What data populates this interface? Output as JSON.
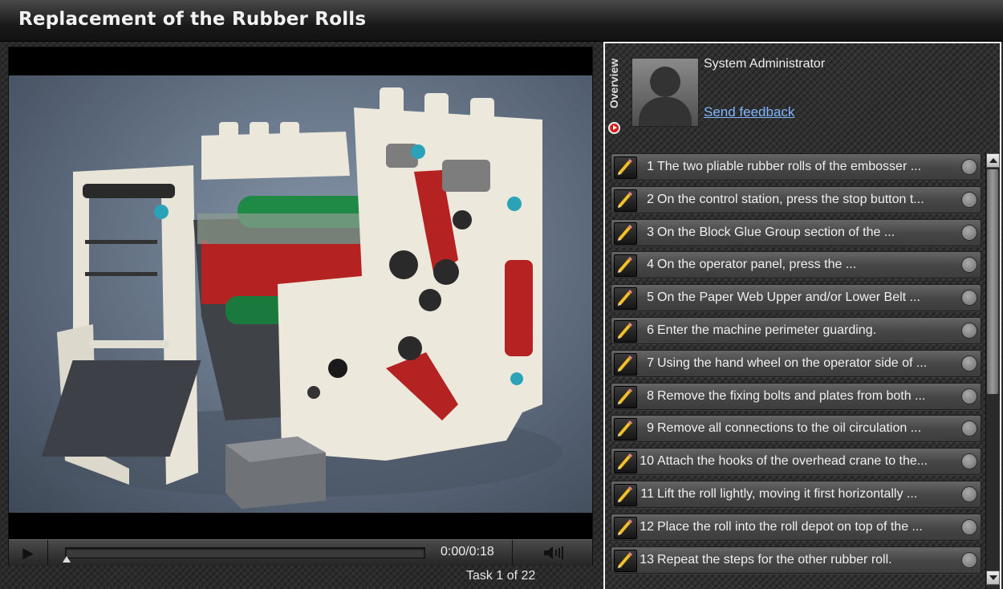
{
  "header": {
    "title": "Replacement of the Rubber Rolls"
  },
  "player": {
    "time_current": "0:00",
    "time_separator": "/",
    "time_total": "0:18",
    "progress": 0.0,
    "task_counter": "Task 1 of 22"
  },
  "panel": {
    "tab_label": "Overview",
    "user_name": "System Administrator",
    "feedback_link": "Send feedback"
  },
  "tasks": [
    {
      "num": "1",
      "text": "The two pliable rubber rolls of the embosser ...",
      "done": false
    },
    {
      "num": "2",
      "text": "On the control station, press the stop button t...",
      "done": false
    },
    {
      "num": "3",
      "text": "On the Block Glue Group section of the ...",
      "done": false
    },
    {
      "num": "4",
      "text": "On the operator panel, press the ...",
      "done": false
    },
    {
      "num": "5",
      "text": "On the Paper Web Upper and/or Lower Belt ...",
      "done": false
    },
    {
      "num": "6",
      "text": "Enter the machine perimeter guarding.",
      "done": false
    },
    {
      "num": "7",
      "text": "Using the hand wheel on the operator side of ...",
      "done": false
    },
    {
      "num": "8",
      "text": "Remove the fixing bolts and plates from both ...",
      "done": false
    },
    {
      "num": "9",
      "text": "Remove all connections to the oil circulation ...",
      "done": false
    },
    {
      "num": "10",
      "text": "Attach the hooks of the overhead crane to the...",
      "done": false
    },
    {
      "num": "11",
      "text": "Lift the roll lightly, moving it first horizontally ...",
      "done": false
    },
    {
      "num": "12",
      "text": "Place the roll into the roll depot on top of the ...",
      "done": false
    },
    {
      "num": "13",
      "text": "Repeat the steps for the other rubber roll.",
      "done": false
    }
  ],
  "icons": {
    "play": "play-icon",
    "volume": "volume-icon",
    "edit": "pencil-icon",
    "status": "circle-status-icon",
    "overview": "play-circle-icon"
  },
  "colors": {
    "accent_red": "#d71c1c",
    "link": "#7fb6ff",
    "panel_border": "#f2f2f2"
  }
}
